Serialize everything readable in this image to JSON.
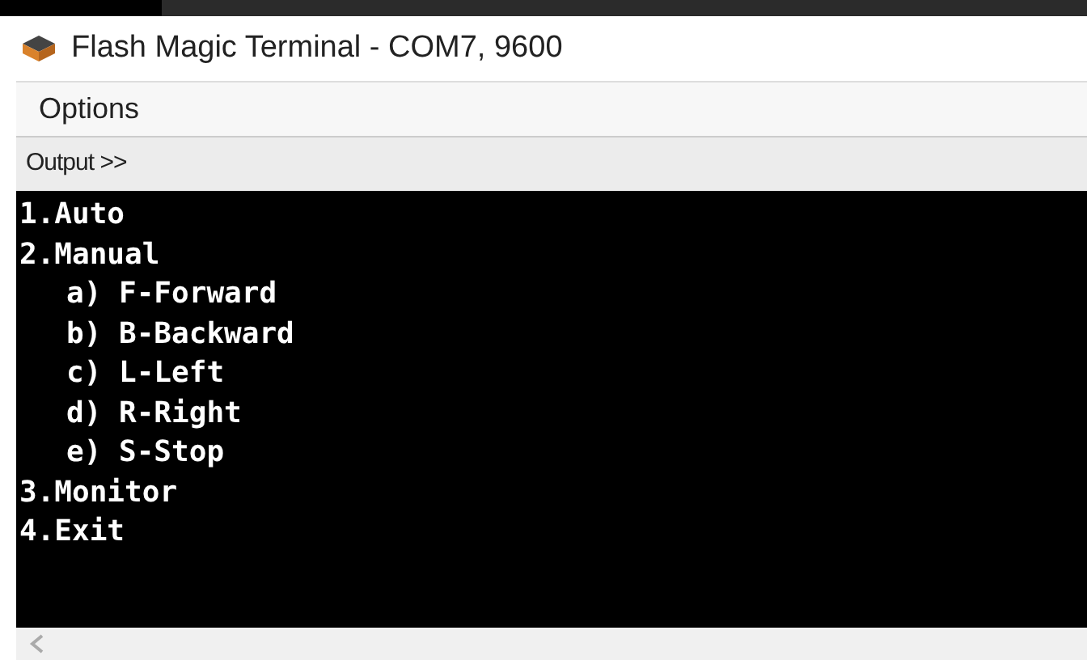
{
  "window": {
    "title": "Flash Magic Terminal - COM7, 9600"
  },
  "menu": [
    "Options"
  ],
  "output_toggle": "Output >>",
  "terminal": {
    "lines": [
      {
        "text": "1.Auto"
      },
      {
        "text": "2.Manual",
        "children": [
          {
            "text": "a) F-Forward"
          },
          {
            "text": "b) B-Backward"
          },
          {
            "text": "c) L-Left"
          },
          {
            "text": "d) R-Right"
          },
          {
            "text": "e) S-Stop"
          }
        ]
      },
      {
        "text": "3.Monitor"
      },
      {
        "text": "4.Exit"
      }
    ]
  }
}
